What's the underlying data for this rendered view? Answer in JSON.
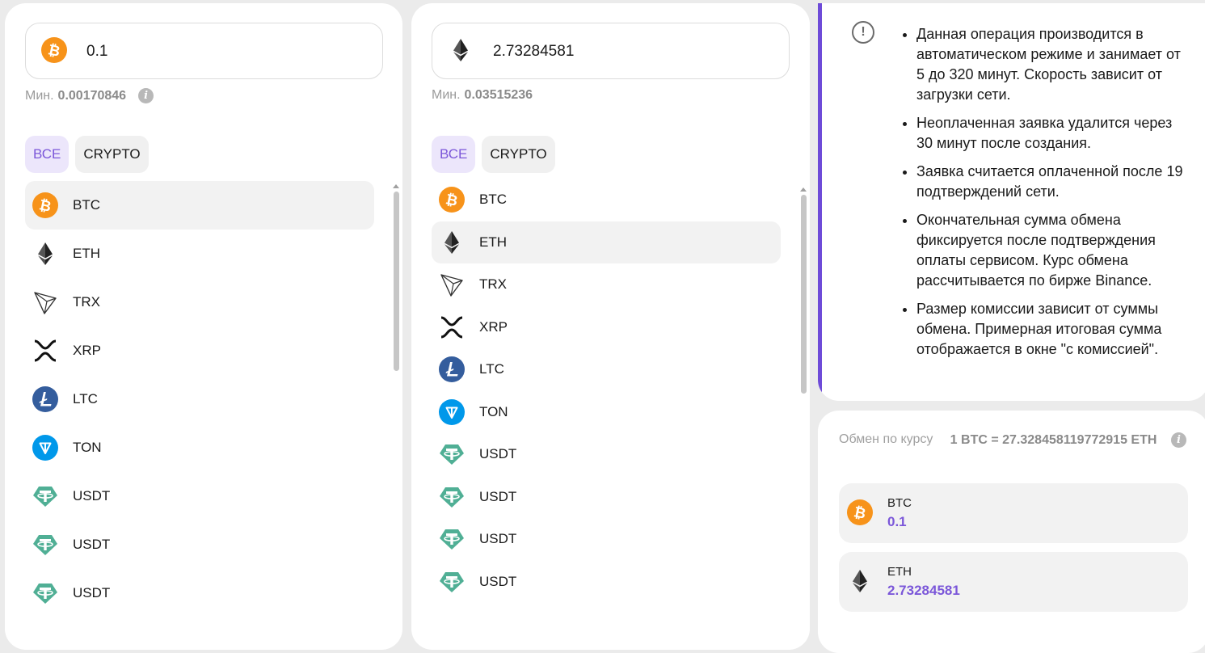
{
  "from": {
    "amount_value": "0.1",
    "min_label": "Мин.",
    "min_value": "0.00170846",
    "filters": [
      {
        "label": "ВСЕ",
        "active": true
      },
      {
        "label": "CRYPTO",
        "active": false
      }
    ],
    "coins": [
      {
        "label": "BTC",
        "icon": "btc-icon",
        "selected": true
      },
      {
        "label": "ETH",
        "icon": "eth-icon",
        "selected": false
      },
      {
        "label": "TRX",
        "icon": "trx-icon",
        "selected": false
      },
      {
        "label": "XRP",
        "icon": "xrp-icon",
        "selected": false
      },
      {
        "label": "LTC",
        "icon": "ltc-icon",
        "selected": false
      },
      {
        "label": "TON",
        "icon": "ton-icon",
        "selected": false
      },
      {
        "label": "USDT",
        "icon": "usdt-icon",
        "selected": false
      },
      {
        "label": "USDT",
        "icon": "usdt-icon",
        "selected": false
      },
      {
        "label": "USDT",
        "icon": "usdt-icon",
        "selected": false
      }
    ]
  },
  "to": {
    "amount_value": "2.73284581",
    "min_label": "Мин.",
    "min_value": "0.03515236",
    "filters": [
      {
        "label": "ВСЕ",
        "active": true
      },
      {
        "label": "CRYPTO",
        "active": false
      }
    ],
    "coins": [
      {
        "label": "BTC",
        "icon": "btc-icon",
        "selected": false
      },
      {
        "label": "ETH",
        "icon": "eth-icon",
        "selected": true
      },
      {
        "label": "TRX",
        "icon": "trx-icon",
        "selected": false
      },
      {
        "label": "XRP",
        "icon": "xrp-icon",
        "selected": false
      },
      {
        "label": "LTC",
        "icon": "ltc-icon",
        "selected": false
      },
      {
        "label": "TON",
        "icon": "ton-icon",
        "selected": false
      },
      {
        "label": "USDT",
        "icon": "usdt-icon",
        "selected": false
      },
      {
        "label": "USDT",
        "icon": "usdt-icon",
        "selected": false
      },
      {
        "label": "USDT",
        "icon": "usdt-icon",
        "selected": false
      },
      {
        "label": "USDT",
        "icon": "usdt-icon",
        "selected": false
      }
    ]
  },
  "info": {
    "notes": [
      "Данная операция производится в автоматическом режиме и занимает от 5 до 320 минут. Скорость зависит от загрузки сети.",
      "Неоплаченная заявка удалится через 30 минут после создания.",
      "Заявка считается оплаченной после 19 подтверждений сети.",
      "Окончательная сумма обмена фиксируется после подтверждения оплаты сервисом. Курс обмена рассчитывается по бирже Binance.",
      "Размер комиссии зависит от суммы обмена. Примерная итоговая сумма отображается в окне \"с комиссией\"."
    ]
  },
  "rate": {
    "label": "Обмен по курсу",
    "value": "1 BTC = 27.328458119772915 ETH",
    "from_ticker": "BTC",
    "from_amount": "0.1",
    "to_ticker": "ETH",
    "to_amount": "2.73284581"
  },
  "colors": {
    "accent": "#7b57d9",
    "btc": "#f7931a",
    "usdt": "#50af95",
    "ltc": "#345d9d",
    "ton": "#0098ea"
  }
}
